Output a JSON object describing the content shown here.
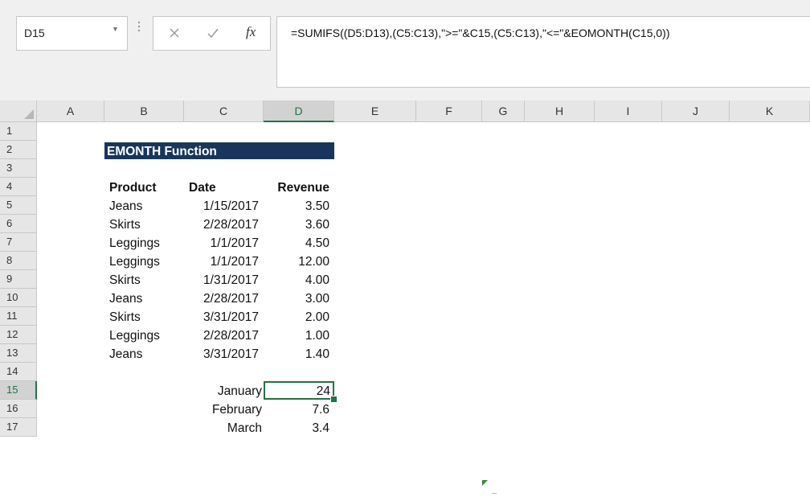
{
  "name_box": {
    "value": "D15"
  },
  "formula_bar": {
    "formula": "=SUMIFS((D5:D13),(C5:C13),\">=\"&C15,(C5:C13),\"<=\"&EOMONTH(C15,0))"
  },
  "columns": [
    "A",
    "B",
    "C",
    "D",
    "E",
    "F",
    "G",
    "H",
    "I",
    "J",
    "K"
  ],
  "selected_column": "D",
  "rows": [
    "1",
    "2",
    "3",
    "4",
    "5",
    "6",
    "7",
    "8",
    "9",
    "10",
    "11",
    "12",
    "13",
    "14",
    "15",
    "16",
    "17"
  ],
  "selected_row": "15",
  "sheet": {
    "title": "EMONTH Function",
    "headers": {
      "product": "Product",
      "date": "Date",
      "revenue": "Revenue"
    },
    "table": [
      {
        "product": "Jeans",
        "date": "1/15/2017",
        "revenue": "3.50"
      },
      {
        "product": "Skirts",
        "date": "2/28/2017",
        "revenue": "3.60"
      },
      {
        "product": "Leggings",
        "date": "1/1/2017",
        "revenue": "4.50"
      },
      {
        "product": "Leggings",
        "date": "1/1/2017",
        "revenue": "12.00"
      },
      {
        "product": "Skirts",
        "date": "1/31/2017",
        "revenue": "4.00"
      },
      {
        "product": "Jeans",
        "date": "2/28/2017",
        "revenue": "3.00"
      },
      {
        "product": "Skirts",
        "date": "3/31/2017",
        "revenue": "2.00"
      },
      {
        "product": "Leggings",
        "date": "2/28/2017",
        "revenue": "1.00"
      },
      {
        "product": "Jeans",
        "date": "3/31/2017",
        "revenue": "1.40"
      }
    ],
    "summary": [
      {
        "month": "January",
        "total": "24"
      },
      {
        "month": "February",
        "total": "7.6"
      },
      {
        "month": "March",
        "total": "3.4"
      }
    ]
  },
  "colors": {
    "accent_green": "#217346",
    "title_fill": "#17365d",
    "header_bg": "#e6e6e6"
  },
  "icons": [
    "cancel-icon",
    "enter-icon",
    "fx-icon",
    "dropdown-arrow-icon"
  ]
}
